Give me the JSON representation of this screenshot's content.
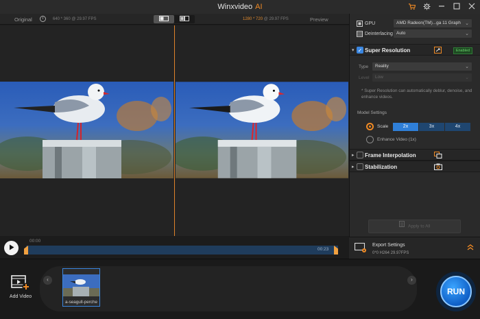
{
  "titlebar": {
    "title": "Winxvideo",
    "title_accent": "AI"
  },
  "preview": {
    "original_label": "Original",
    "source_info": "640 * 360 @ 29.97 FPS",
    "output_res": "1280 * 720",
    "output_fps": "@ 29.97 FPS",
    "preview_label": "Preview"
  },
  "timeline": {
    "start_time": "00:00",
    "end_time": "00:23"
  },
  "settings": {
    "gpu_label": "GPU",
    "gpu_value": "AMD Radeon(TM)...ga 11 Graph",
    "deinterlacing_label": "Deinterlacing",
    "deinterlacing_value": "Auto",
    "super_resolution": {
      "title": "Super Resolution",
      "badge": "Enabled",
      "type_label": "Type",
      "type_value": "Reality",
      "level_label": "Level",
      "level_value": "Low",
      "note": "* Super Resolution can automatically deblur, denoise, and enhance videos.",
      "model_settings_label": "Model Settings",
      "scale_label": "Scale",
      "scale_options": [
        "2x",
        "3x",
        "4x"
      ],
      "enhance_label": "Enhance Video (1x)"
    },
    "frame_interpolation_title": "Frame Interpolation",
    "stabilization_title": "Stabilization",
    "apply_all_label": "Apply to All"
  },
  "export": {
    "title": "Export Settings",
    "sub": "0*0  H264  29.97FPS"
  },
  "bottom": {
    "add_video_label": "Add Video",
    "thumbnail_caption": "a-seagull-perche",
    "run_label": "RUN"
  },
  "colors": {
    "accent": "#f08a24",
    "blue": "#2f7fd8",
    "enabled_green": "#6ad46d"
  }
}
